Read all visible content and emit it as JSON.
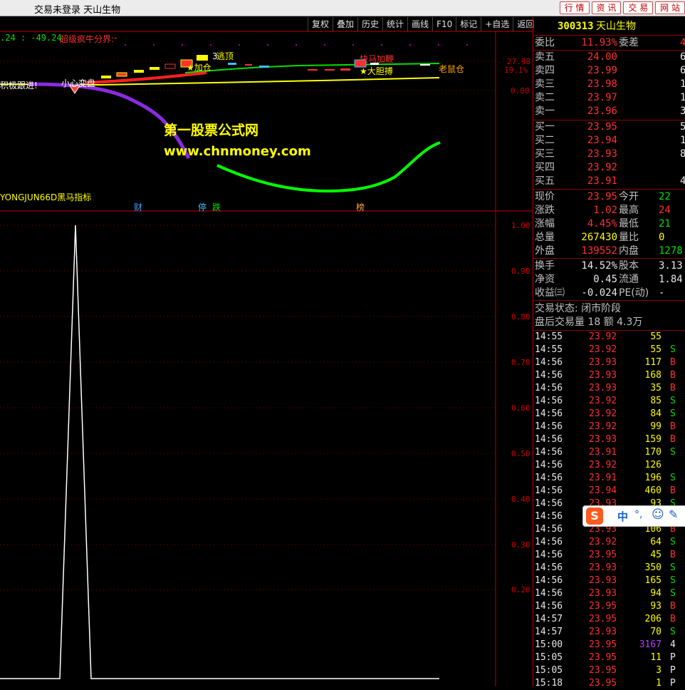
{
  "title": "交易未登录  天山生物",
  "topnav": [
    "行 情",
    "资 讯",
    "交 易",
    "网 站"
  ],
  "toolbar": [
    "复权",
    "叠加",
    "历史",
    "统计",
    "画线",
    "F10",
    "标记",
    "+自选",
    "返回"
  ],
  "upper": {
    "header_values": ".24 : -49.24",
    "header_label": "超级疯牛分界:",
    "header_sep": "-",
    "indicator_name": "YONGJUN66D黑马指标",
    "watermark1": "第一股票公式网",
    "watermark2": "www.chnmoney.com",
    "axis": [
      "27.98",
      "19.1%",
      "0.00"
    ],
    "labels": {
      "t1": "逃顶",
      "t2": "★加仓",
      "t3": "快马加鞭",
      "t4": "★大胆搏",
      "t5": "老鼠仓",
      "t6": "小心变盘",
      "t7": "积极跟进!",
      "t8": "3"
    },
    "markers": [
      "财",
      "停",
      "跌",
      "榜"
    ]
  },
  "lower": {
    "axis": [
      "1.00",
      "0.90",
      "0.80",
      "0.70",
      "0.60",
      "0.50",
      "0.40",
      "0.30",
      "0.20"
    ]
  },
  "quote": {
    "code": "300313",
    "name": "天山生物",
    "wb_label": "委比",
    "wb_val": "11.93%",
    "wc_label": "委差",
    "wc_val": "4",
    "sell": [
      {
        "label": "卖五",
        "price": "24.00",
        "vol": "6"
      },
      {
        "label": "卖四",
        "price": "23.99",
        "vol": "6"
      },
      {
        "label": "卖三",
        "price": "23.98",
        "vol": "1"
      },
      {
        "label": "卖二",
        "price": "23.97",
        "vol": "1"
      },
      {
        "label": "卖一",
        "price": "23.96",
        "vol": "3"
      }
    ],
    "buy": [
      {
        "label": "买一",
        "price": "23.95",
        "vol": "5"
      },
      {
        "label": "买二",
        "price": "23.94",
        "vol": "1"
      },
      {
        "label": "买三",
        "price": "23.93",
        "vol": "8"
      },
      {
        "label": "买四",
        "price": "23.92",
        "vol": ""
      },
      {
        "label": "买五",
        "price": "23.91",
        "vol": "4"
      }
    ],
    "stats": [
      {
        "l1": "现价",
        "v1": "23.95",
        "c1": "red",
        "l2": "今开",
        "v2": "22",
        "c2": "green"
      },
      {
        "l1": "涨跌",
        "v1": "1.02",
        "c1": "red",
        "l2": "最高",
        "v2": "24",
        "c2": "red"
      },
      {
        "l1": "涨幅",
        "v1": "4.45%",
        "c1": "red",
        "l2": "最低",
        "v2": "21",
        "c2": "green"
      },
      {
        "l1": "总量",
        "v1": "267430",
        "c1": "yellow",
        "l2": "量比",
        "v2": "0",
        "c2": "yellow"
      },
      {
        "l1": "外盘",
        "v1": "139552",
        "c1": "red",
        "l2": "内盘",
        "v2": "1278",
        "c2": "green"
      }
    ],
    "stats2": [
      {
        "l1": "换手",
        "v1": "14.52%",
        "l2": "股本",
        "v2": "3.13"
      },
      {
        "l1": "净资",
        "v1": "0.45",
        "l2": "流通",
        "v2": "1.84"
      },
      {
        "l1": "收益㈢",
        "v1": "-0.024",
        "l2": "PE(动)",
        "v2": "-"
      }
    ],
    "status": "交易状态: 闭市阶段",
    "after": "盘后交易量 18 额 4.3万",
    "ticks": [
      {
        "t": "14:55",
        "p": "23.92",
        "v": "55",
        "s": ""
      },
      {
        "t": "14:55",
        "p": "23.92",
        "v": "55",
        "s": "S"
      },
      {
        "t": "14:56",
        "p": "23.93",
        "v": "117",
        "s": "B"
      },
      {
        "t": "14:56",
        "p": "23.93",
        "v": "168",
        "s": "B"
      },
      {
        "t": "14:56",
        "p": "23.93",
        "v": "35",
        "s": "B"
      },
      {
        "t": "14:56",
        "p": "23.92",
        "v": "85",
        "s": "S"
      },
      {
        "t": "14:56",
        "p": "23.92",
        "v": "84",
        "s": "S"
      },
      {
        "t": "14:56",
        "p": "23.92",
        "v": "99",
        "s": "B"
      },
      {
        "t": "14:56",
        "p": "23.93",
        "v": "159",
        "s": "B"
      },
      {
        "t": "14:56",
        "p": "23.91",
        "v": "170",
        "s": "S"
      },
      {
        "t": "14:56",
        "p": "23.92",
        "v": "126",
        "s": ""
      },
      {
        "t": "14:56",
        "p": "23.91",
        "v": "196",
        "s": "S"
      },
      {
        "t": "14:56",
        "p": "23.94",
        "v": "460",
        "s": "B"
      },
      {
        "t": "14:56",
        "p": "23.93",
        "v": "93",
        "s": "S"
      },
      {
        "t": "14:56",
        "p": "",
        "v": "",
        "s": ""
      },
      {
        "t": "14:56",
        "p": "23.93",
        "v": "106",
        "s": "B"
      },
      {
        "t": "14:56",
        "p": "23.92",
        "v": "64",
        "s": "S"
      },
      {
        "t": "14:56",
        "p": "23.95",
        "v": "45",
        "s": "B"
      },
      {
        "t": "14:56",
        "p": "23.93",
        "v": "350",
        "s": "S"
      },
      {
        "t": "14:56",
        "p": "23.93",
        "v": "165",
        "s": "S"
      },
      {
        "t": "14:56",
        "p": "23.93",
        "v": "94",
        "s": "S"
      },
      {
        "t": "14:56",
        "p": "23.95",
        "v": "93",
        "s": "B"
      },
      {
        "t": "14:57",
        "p": "23.95",
        "v": "206",
        "s": "B"
      },
      {
        "t": "14:57",
        "p": "23.93",
        "v": "70",
        "s": "S"
      },
      {
        "t": "15:00",
        "p": "23.95",
        "v": "3167",
        "s": "4"
      },
      {
        "t": "15:05",
        "p": "23.95",
        "v": "11",
        "s": "P"
      },
      {
        "t": "15:05",
        "p": "23.95",
        "v": "3",
        "s": "P"
      },
      {
        "t": "15:18",
        "p": "23.95",
        "v": "1",
        "s": "P"
      }
    ]
  },
  "ime": {
    "label": "中",
    "punct": "°,"
  },
  "colors": {
    "up": "#ff3030",
    "down": "#00e000",
    "accent": "#ffff00",
    "border": "#c00000",
    "purple": "#8a2be2"
  }
}
